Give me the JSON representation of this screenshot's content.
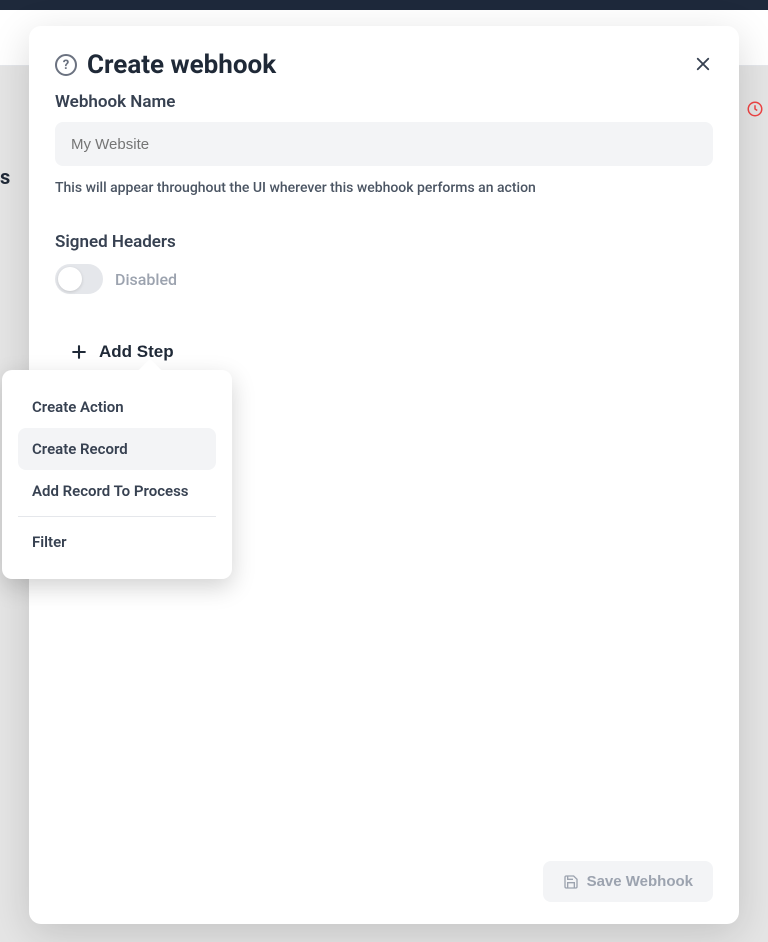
{
  "modal": {
    "title": "Create webhook",
    "name_label": "Webhook Name",
    "name_placeholder": "My Website",
    "helper_text": "This will appear throughout the UI wherever this webhook performs an action",
    "signed_headers_label": "Signed Headers",
    "toggle_status": "Disabled",
    "add_step_label": "Add Step",
    "save_label": "Save Webhook"
  },
  "dropdown": {
    "items": [
      {
        "label": "Create Action"
      },
      {
        "label": "Create Record"
      },
      {
        "label": "Add Record To Process"
      },
      {
        "label": "Filter"
      }
    ]
  },
  "background": {
    "sidebar_letter": "s"
  }
}
